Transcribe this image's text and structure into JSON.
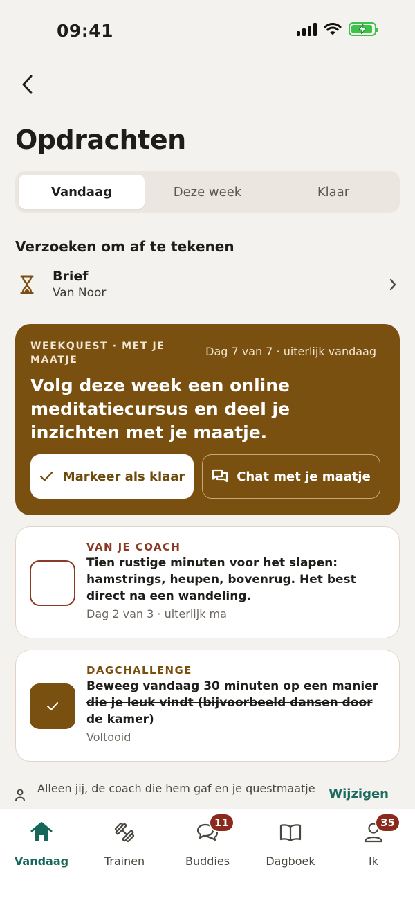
{
  "status_bar": {
    "time": "09:41"
  },
  "page": {
    "title": "Opdrachten"
  },
  "tabs": [
    {
      "label": "Vandaag",
      "active": true
    },
    {
      "label": "Deze week",
      "active": false
    },
    {
      "label": "Klaar",
      "active": false
    }
  ],
  "requests": {
    "section_title": "Verzoeken om af te tekenen",
    "items": [
      {
        "icon": "hourglass-icon",
        "title": "Brief",
        "subtitle": "Van Noor"
      }
    ]
  },
  "weekquest": {
    "label": "WEEKQUEST · MET JE MAATJE",
    "due": "Dag 7 van 7 · uiterlijk vandaag",
    "text": "Volg deze week een online meditatiecursus en deel je inzichten met je maatje.",
    "done_button": "Markeer als klaar",
    "chat_button": "Chat met je maatje",
    "background": "#7a5010"
  },
  "tasks": [
    {
      "label": "VAN JE COACH",
      "text": "Tien rustige minuten voor het slapen: hamstrings, heupen, bovenrug. Het best direct na een wandeling.",
      "meta": "Dag 2 van 3 · uiterlijk ma",
      "completed": false,
      "label_color": "#8a3a24"
    },
    {
      "label": "DAGCHALLENGE",
      "text": "Beweeg vandaag 30 minuten op een manier die je leuk vindt (bijvoorbeeld dansen door de kamer)",
      "meta": "Voltooid",
      "completed": true,
      "label_color": "#7a5010"
    }
  ],
  "privacy": {
    "text": "Alleen jij, de coach die hem gaf en je questmaatje",
    "edit_label": "Wijzigen"
  },
  "bottom_nav": [
    {
      "label": "Vandaag",
      "icon": "home-icon",
      "active": true,
      "badge": ""
    },
    {
      "label": "Trainen",
      "icon": "dumbbell-icon",
      "active": false,
      "badge": ""
    },
    {
      "label": "Buddies",
      "icon": "chat-bubbles-icon",
      "active": false,
      "badge": "11"
    },
    {
      "label": "Dagboek",
      "icon": "book-icon",
      "active": false,
      "badge": ""
    },
    {
      "label": "Ik",
      "icon": "person-icon",
      "active": false,
      "badge": "35"
    }
  ],
  "colors": {
    "accent_green": "#17665a",
    "brown": "#7a5010",
    "badge_red": "#8a2a1c"
  }
}
